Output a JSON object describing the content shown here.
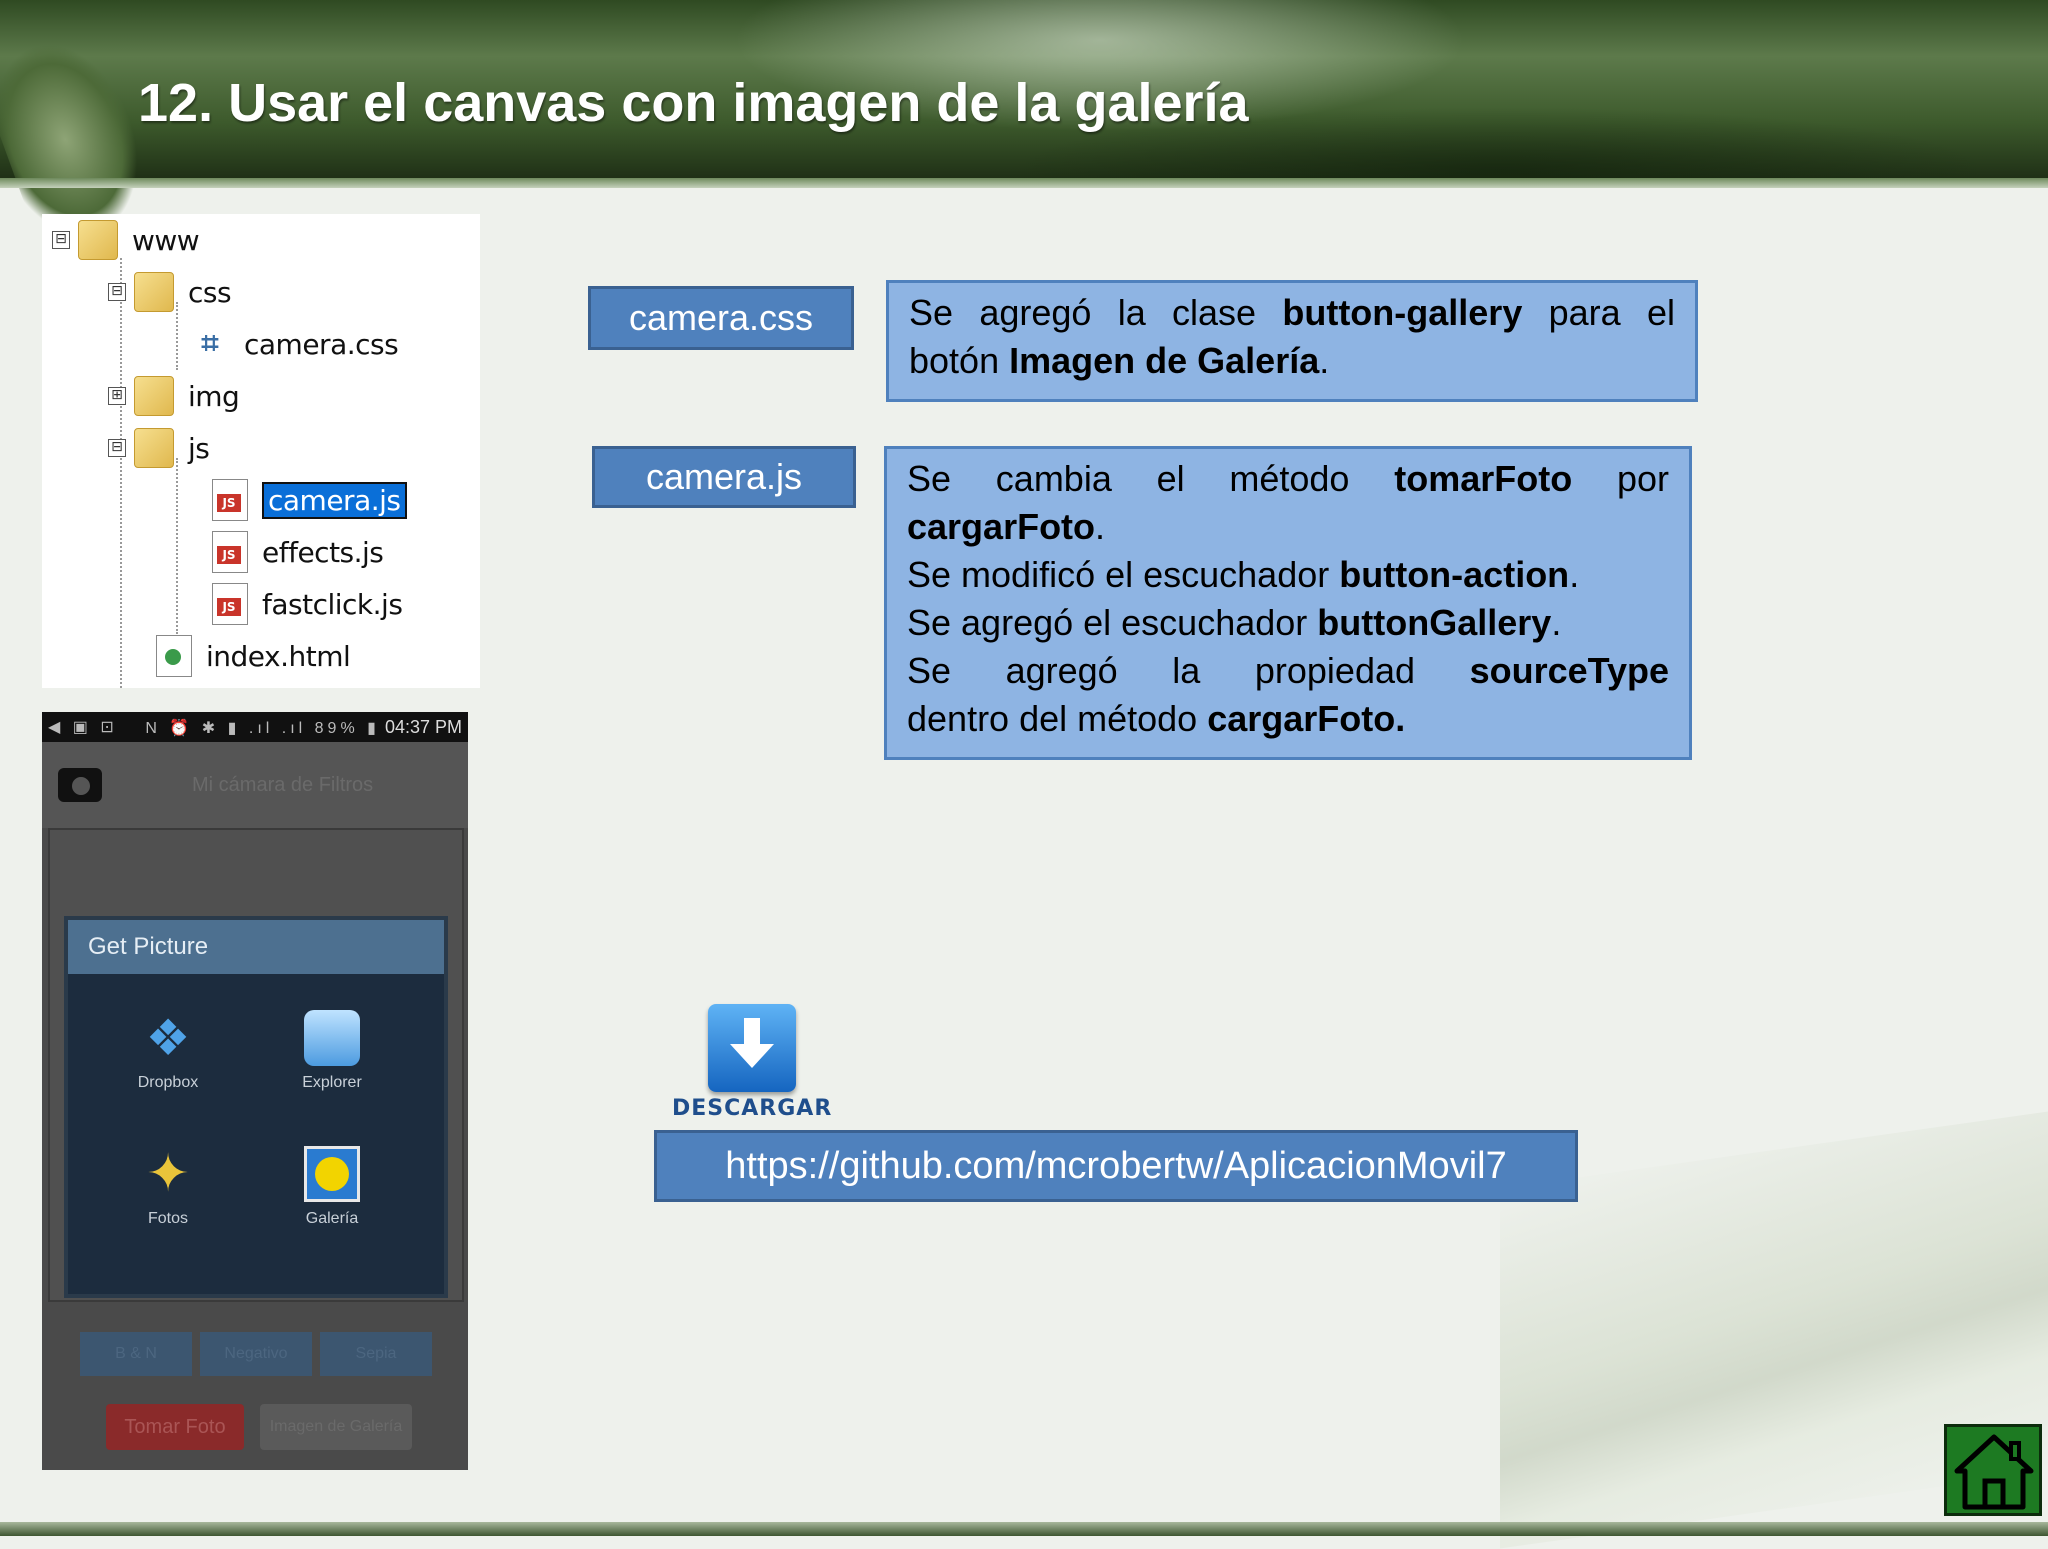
{
  "slide": {
    "title": "12. Usar el canvas con imagen de la galería"
  },
  "file_tree": {
    "nodes": [
      {
        "label": "www",
        "type": "folder",
        "expanded": true
      },
      {
        "label": "css",
        "type": "folder",
        "expanded": true
      },
      {
        "label": "camera.css",
        "type": "css-file"
      },
      {
        "label": "img",
        "type": "folder",
        "expanded": false
      },
      {
        "label": "js",
        "type": "folder",
        "expanded": true
      },
      {
        "label": "camera.js",
        "type": "js-file",
        "selected": true
      },
      {
        "label": "effects.js",
        "type": "js-file"
      },
      {
        "label": "fastclick.js",
        "type": "js-file"
      },
      {
        "label": "index.html",
        "type": "html-file"
      }
    ],
    "toggle_collapse": "⊟",
    "toggle_expand": "⊞"
  },
  "phone": {
    "status_time": "04:37 PM",
    "status_icons_left": "◀ ▣ ⊡",
    "status_icons_right": "N ⏰ ✱ ▮ .ıl .ıl 89% ▮",
    "app_title": "Mi cámara de Filtros",
    "dialog_title": "Get Picture",
    "dialog_options": [
      {
        "label": "Dropbox",
        "icon": "dropbox-icon"
      },
      {
        "label": "Explorer",
        "icon": "explorer-icon"
      },
      {
        "label": "Fotos",
        "icon": "fotos-icon"
      },
      {
        "label": "Galería",
        "icon": "galeria-icon"
      }
    ],
    "filter_buttons": [
      "B & N",
      "Negativo",
      "Sepia"
    ],
    "take_photo_label": "Tomar Foto",
    "gallery_label": "Imagen de Galería"
  },
  "labels": {
    "css_file": "camera.css",
    "js_file": "camera.js"
  },
  "css_description": {
    "line1_pre": "Se agregó la clase ",
    "line1_bold": "button-gallery",
    "line1_post": " para el",
    "line2_pre": "botón ",
    "line2_bold": "Imagen de Galería",
    "line2_post": "."
  },
  "js_description": {
    "line1_pre": "Se cambia el método ",
    "line1_bold": "tomarFoto",
    "line1_post": " por",
    "line2_bold": "cargarFoto",
    "line2_post": ".",
    "line3_pre": "Se modificó el escuchador ",
    "line3_bold": "button-action",
    "line3_post": ".",
    "line4_pre": "Se agregó el escuchador ",
    "line4_bold": "buttonGallery",
    "line4_post": ".",
    "line5_pre": "Se agregó la propiedad ",
    "line5_bold": "sourceType",
    "line6_pre": "dentro del método ",
    "line6_bold": "cargarFoto."
  },
  "download": {
    "label": "DESCARGAR",
    "url": "https://github.com/mcrobertw/AplicacionMovil7"
  },
  "colors": {
    "label_blue": "#4f81bd",
    "desc_blue": "#8eb4e3",
    "home_green": "#1d7a22"
  }
}
